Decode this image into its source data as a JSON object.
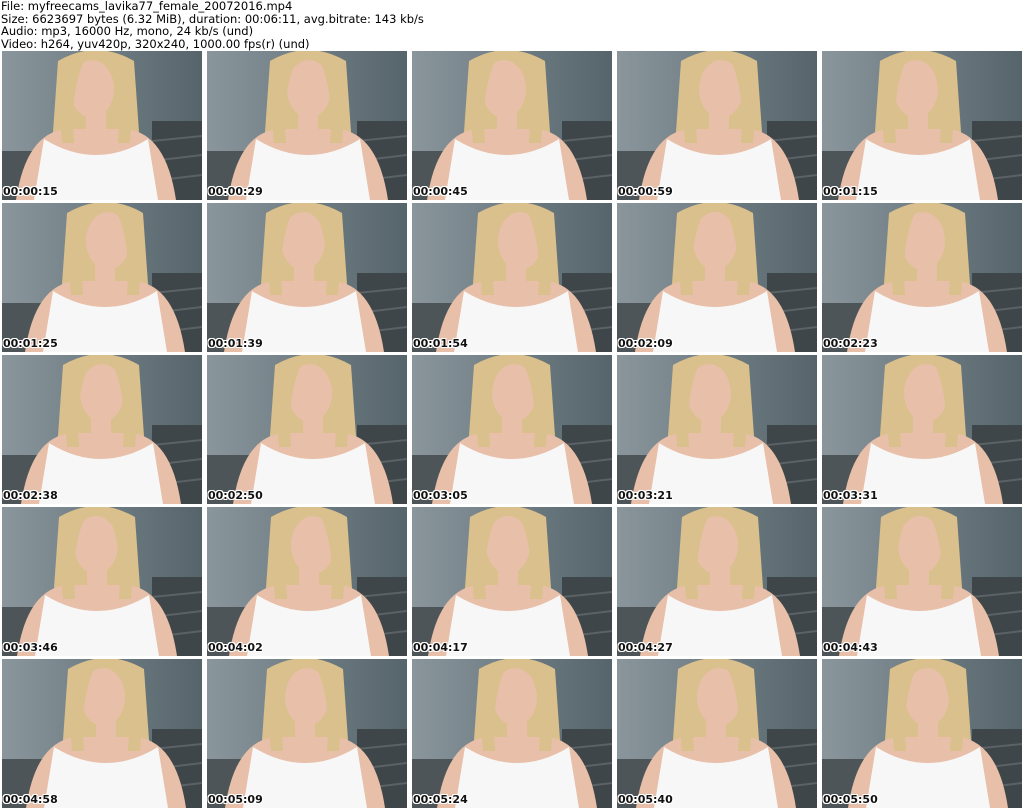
{
  "header": {
    "file_line": "File: myfreecams_lavika77_female_20072016.mp4",
    "size_line": "Size: 6623697 bytes (6.32 MiB), duration: 00:06:11, avg.bitrate: 143 kb/s",
    "audio_line": "Audio: mp3, 16000 Hz, mono, 24 kb/s (und)",
    "video_line": "Video: h264, yuv420p, 320x240, 1000.00 fps(r) (und)"
  },
  "thumbnails": [
    {
      "timestamp": "00:00:15"
    },
    {
      "timestamp": "00:00:29"
    },
    {
      "timestamp": "00:00:45"
    },
    {
      "timestamp": "00:00:59"
    },
    {
      "timestamp": "00:01:15"
    },
    {
      "timestamp": "00:01:25"
    },
    {
      "timestamp": "00:01:39"
    },
    {
      "timestamp": "00:01:54"
    },
    {
      "timestamp": "00:02:09"
    },
    {
      "timestamp": "00:02:23"
    },
    {
      "timestamp": "00:02:38"
    },
    {
      "timestamp": "00:02:50"
    },
    {
      "timestamp": "00:03:05"
    },
    {
      "timestamp": "00:03:21"
    },
    {
      "timestamp": "00:03:31"
    },
    {
      "timestamp": "00:03:46"
    },
    {
      "timestamp": "00:04:02"
    },
    {
      "timestamp": "00:04:17"
    },
    {
      "timestamp": "00:04:27"
    },
    {
      "timestamp": "00:04:43"
    },
    {
      "timestamp": "00:04:58"
    },
    {
      "timestamp": "00:05:09"
    },
    {
      "timestamp": "00:05:24"
    },
    {
      "timestamp": "00:05:40"
    },
    {
      "timestamp": "00:05:50"
    }
  ],
  "colors": {
    "background": "#ffffff",
    "wall": "#6f7d84",
    "hair": "#d9c08c",
    "skin": "#e8bfa8",
    "top": "#f7f7f7"
  }
}
